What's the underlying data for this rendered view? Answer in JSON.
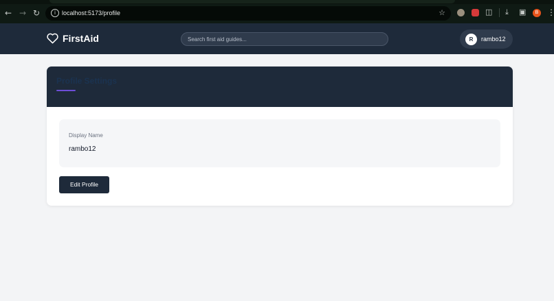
{
  "browser": {
    "url": "localhost:5173/profile",
    "profile_initial": "B",
    "icons": [
      "back-icon",
      "forward-icon",
      "reload-icon",
      "site-info-icon",
      "star-icon",
      "extensions-icon",
      "download-icon",
      "menu-icon"
    ]
  },
  "header": {
    "brand": "FirstAid",
    "brand_icon": "heart-icon",
    "search_placeholder": "Search first aid guides...",
    "user": {
      "initial": "R",
      "name": "rambo12"
    }
  },
  "profile": {
    "title": "Profile Settings",
    "display_name_label": "Display Name",
    "display_name_value": "rambo12",
    "edit_button": "Edit Profile"
  },
  "colors": {
    "header_bg": "#1e2a3a",
    "accent": "#6d4ed8",
    "page_bg": "#f3f4f6",
    "browser_profile": "#e8541c"
  }
}
